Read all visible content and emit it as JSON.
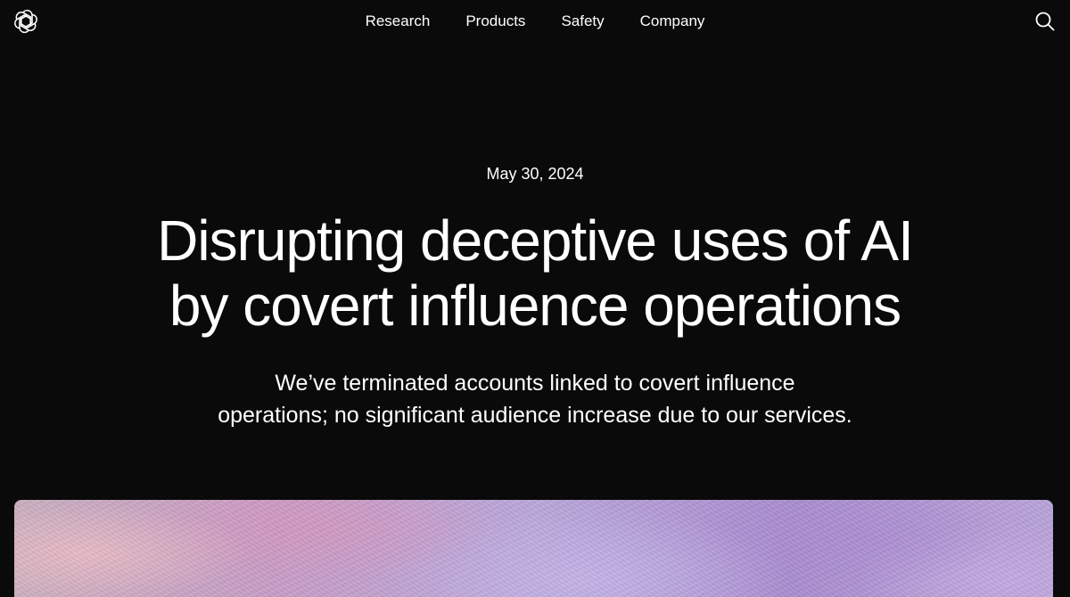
{
  "nav": {
    "logo_icon": "openai-logo-icon",
    "links": [
      "Research",
      "Products",
      "Safety",
      "Company"
    ],
    "search_icon": "search-icon"
  },
  "article": {
    "date": "May 30, 2024",
    "title_line1": "Disrupting deceptive uses of AI",
    "title_line2": "by covert influence operations",
    "subtitle_line1": "We’ve terminated accounts linked to covert influence",
    "subtitle_line2": "operations; no significant audience increase due to our services."
  },
  "colors": {
    "background": "#0a0a0a",
    "text": "#ffffff",
    "hero_gradient": [
      "#c9aebf",
      "#c79cc6",
      "#b9a6da",
      "#a98ccf"
    ]
  }
}
